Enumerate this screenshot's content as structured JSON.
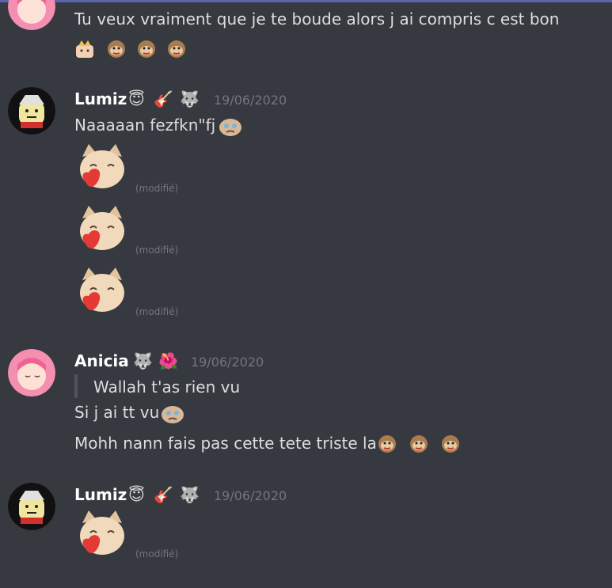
{
  "header": {
    "accent": "#5865a8"
  },
  "messages_top": {
    "text": "Tu veux vraiment que je te boude alors j ai compris c est bon",
    "emotes": [
      "princess-emote",
      "monkey-emote",
      "monkey-emote",
      "monkey-emote"
    ]
  },
  "lumiz1": {
    "name": "Lumiz",
    "badges": [
      "😇",
      "🎸",
      "🐺"
    ],
    "timestamp": "19/06/2020",
    "line1": "Naaaaan fezfkn\"fj",
    "edited1": "(modifié)",
    "edited2": "(modifié)",
    "edited3": "(modifié)"
  },
  "anicia": {
    "name": "Anicia",
    "badges": [
      "🐺",
      "🌺"
    ],
    "timestamp": "19/06/2020",
    "quote": "Wallah t'as rien vu",
    "line1": "Si j ai tt vu",
    "line2": "Mohh nann fais pas cette tete triste la"
  },
  "lumiz2": {
    "name": "Lumiz",
    "badges": [
      "😇",
      "🎸",
      "🐺"
    ],
    "timestamp": "19/06/2020",
    "edited1": "(modifié)"
  },
  "colors": {
    "background": "#36393f",
    "text": "#dcddde",
    "muted": "#72767d",
    "name": "#ffffff"
  }
}
